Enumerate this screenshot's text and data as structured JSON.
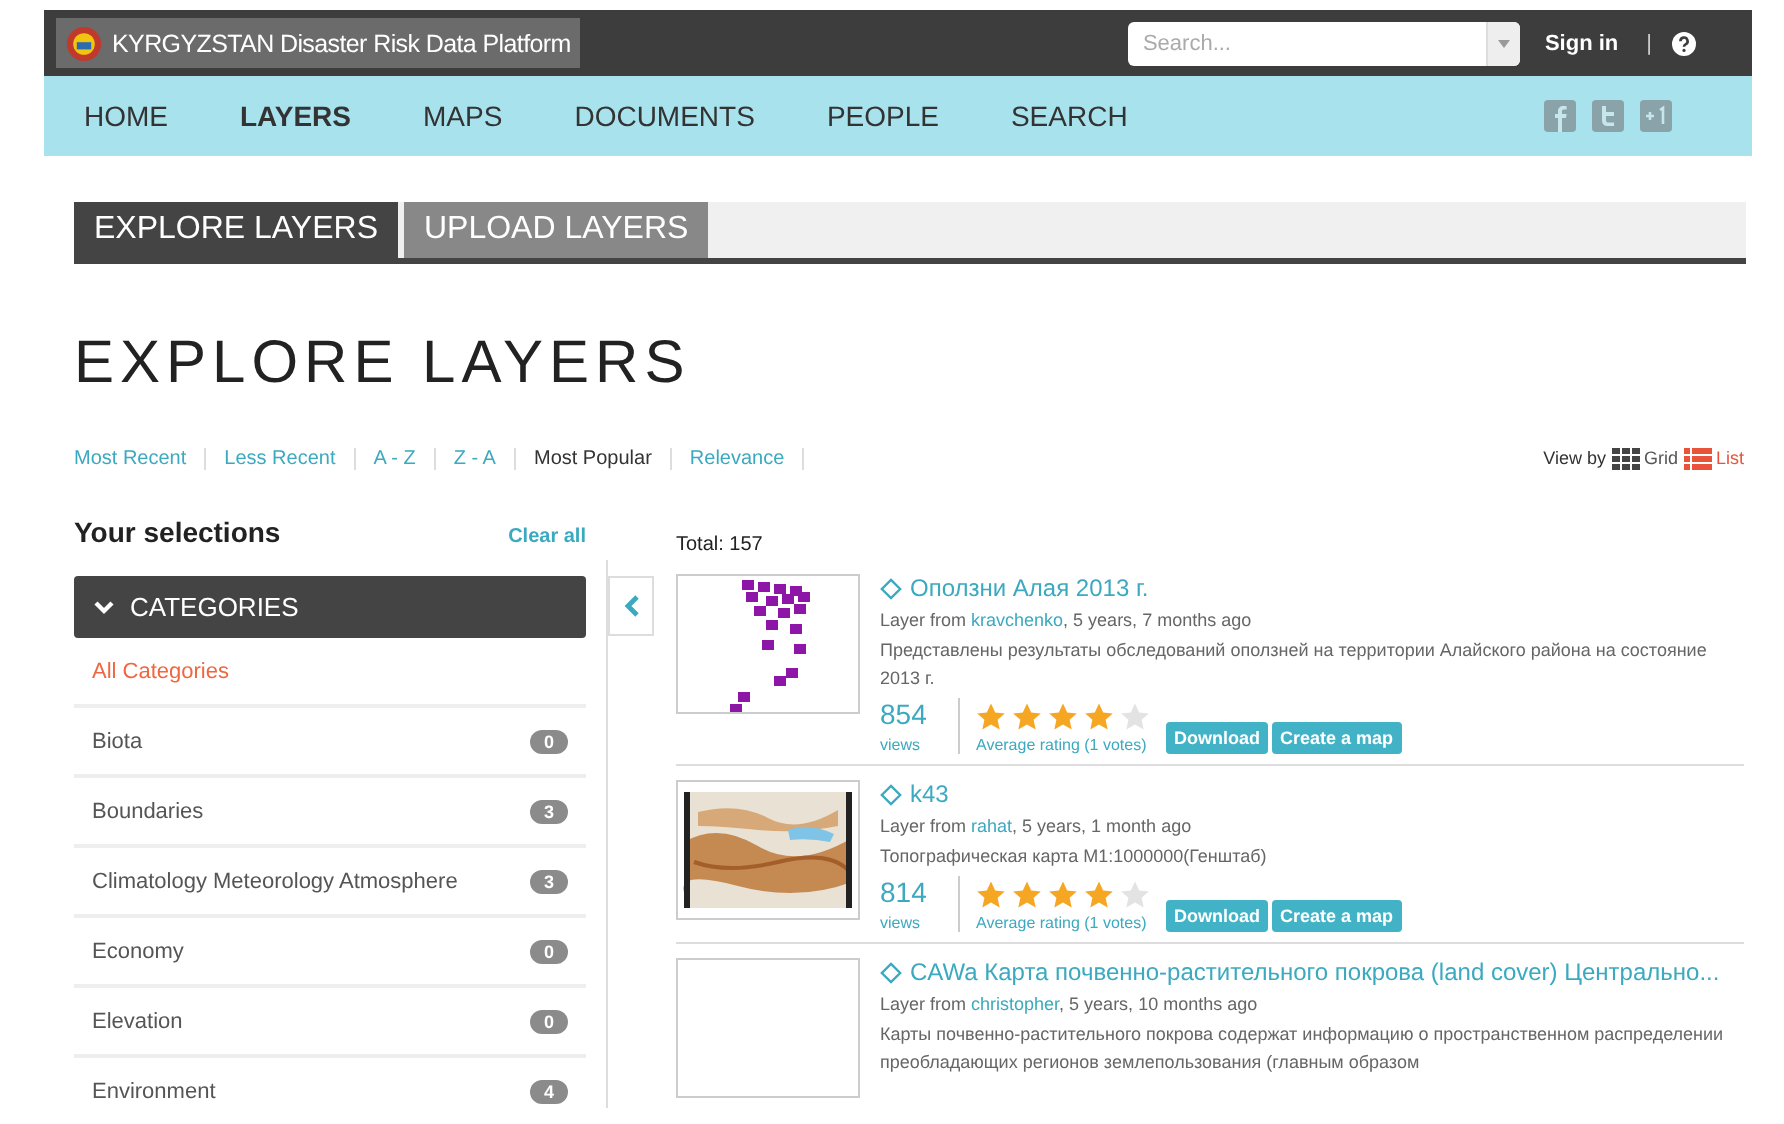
{
  "header": {
    "site_title": "KYRGYZSTAN Disaster Risk Data Platform",
    "search": {
      "placeholder": "Search..."
    },
    "sign_in": "Sign in",
    "separator": "|"
  },
  "nav": [
    {
      "label": "HOME",
      "selected": false
    },
    {
      "label": "LAYERS",
      "selected": true
    },
    {
      "label": "MAPS",
      "selected": false
    },
    {
      "label": "DOCUMENTS",
      "selected": false
    },
    {
      "label": "PEOPLE",
      "selected": false
    },
    {
      "label": "SEARCH",
      "selected": false
    }
  ],
  "tabs": [
    {
      "label": "EXPLORE LAYERS",
      "selected": true
    },
    {
      "label": "UPLOAD LAYERS",
      "selected": false
    }
  ],
  "heading": "EXPLORE LAYERS",
  "sort": [
    {
      "label": "Most Recent",
      "selected": false
    },
    {
      "label": "Less Recent",
      "selected": false
    },
    {
      "label": "A - Z",
      "selected": false
    },
    {
      "label": "Z - A",
      "selected": false
    },
    {
      "label": "Most Popular",
      "selected": true
    },
    {
      "label": "Relevance",
      "selected": false
    }
  ],
  "view_by": {
    "label": "View by",
    "options": [
      {
        "label": "Grid",
        "selected": false
      },
      {
        "label": "List",
        "selected": true
      }
    ]
  },
  "sidebar": {
    "title": "Your selections",
    "clear": "Clear all",
    "section": "CATEGORIES",
    "expanded": true,
    "items": [
      {
        "label": "All Categories",
        "selected": true
      },
      {
        "label": "Biota",
        "count": "0",
        "selected": false
      },
      {
        "label": "Boundaries",
        "count": "3",
        "selected": false
      },
      {
        "label": "Climatology Meteorology Atmosphere",
        "count": "3",
        "selected": false
      },
      {
        "label": "Economy",
        "count": "0",
        "selected": false
      },
      {
        "label": "Elevation",
        "count": "0",
        "selected": false
      },
      {
        "label": "Environment",
        "count": "4",
        "selected": false
      }
    ]
  },
  "total": "Total: 157",
  "results": [
    {
      "title": "Оползни Алая 2013 г.",
      "prefix": "Layer from",
      "author": "kravchenko",
      "age": ", 5 years, 7 months ago",
      "description": "Представлены результаты обследований оползней на территории Алайского района на состояние 2013 г.",
      "views": "854",
      "views_label": "views",
      "stars": 4,
      "rating": "Average rating (1 votes)",
      "buttons": [
        "Download",
        "Create a map"
      ]
    },
    {
      "title": "k43",
      "prefix": "Layer from",
      "author": "rahat",
      "age": ", 5 years, 1 month ago",
      "description": "Топографическая карта М1:1000000(Генштаб)",
      "views": "814",
      "views_label": "views",
      "stars": 4,
      "rating": "Average rating (1 votes)",
      "buttons": [
        "Download",
        "Create a map"
      ]
    },
    {
      "title": "CAWa Карта почвенно-растительного покрова (land cover) Центрально...",
      "prefix": "Layer from",
      "author": "christopher",
      "age": ", 5 years, 10 months ago",
      "description": "Карты почвенно-растительного покрова содержат информацию о пространственном распределении преобладающих регионов землепользования (главным образом"
    }
  ]
}
